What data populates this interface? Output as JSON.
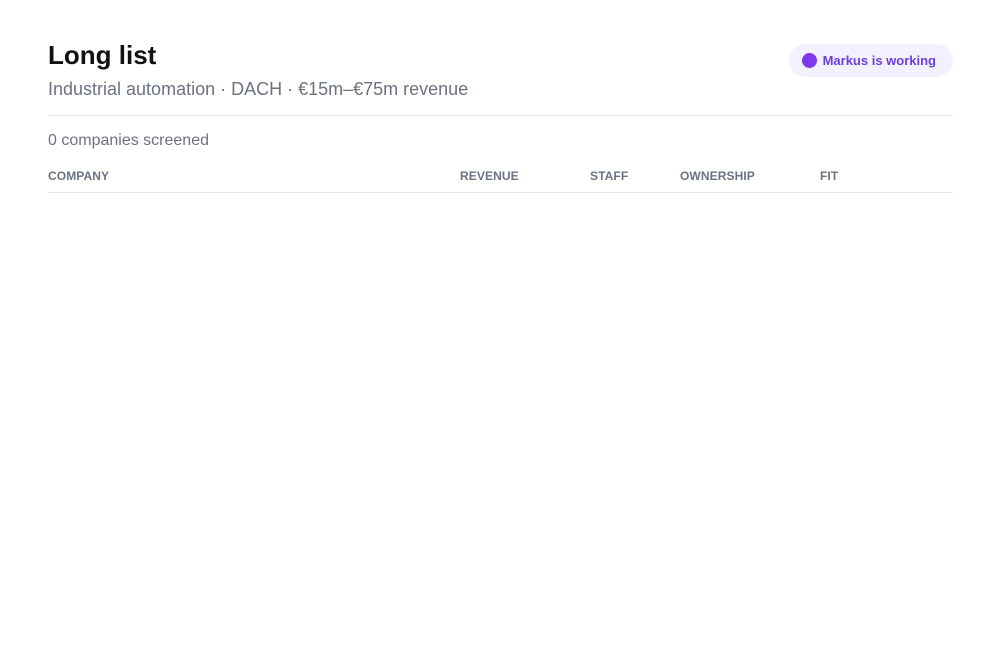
{
  "header": {
    "title": "Long list",
    "subtitle": "Industrial automation · DACH · €15m–€75m revenue",
    "status": {
      "text": "Markus is working",
      "dot_color": "#7c3aed"
    }
  },
  "summary": {
    "count_text": "0 companies screened"
  },
  "table": {
    "columns": {
      "company": "COMPANY",
      "revenue": "REVENUE",
      "staff": "STAFF",
      "ownership": "OWNERSHIP",
      "fit": "FIT"
    },
    "rows": []
  }
}
